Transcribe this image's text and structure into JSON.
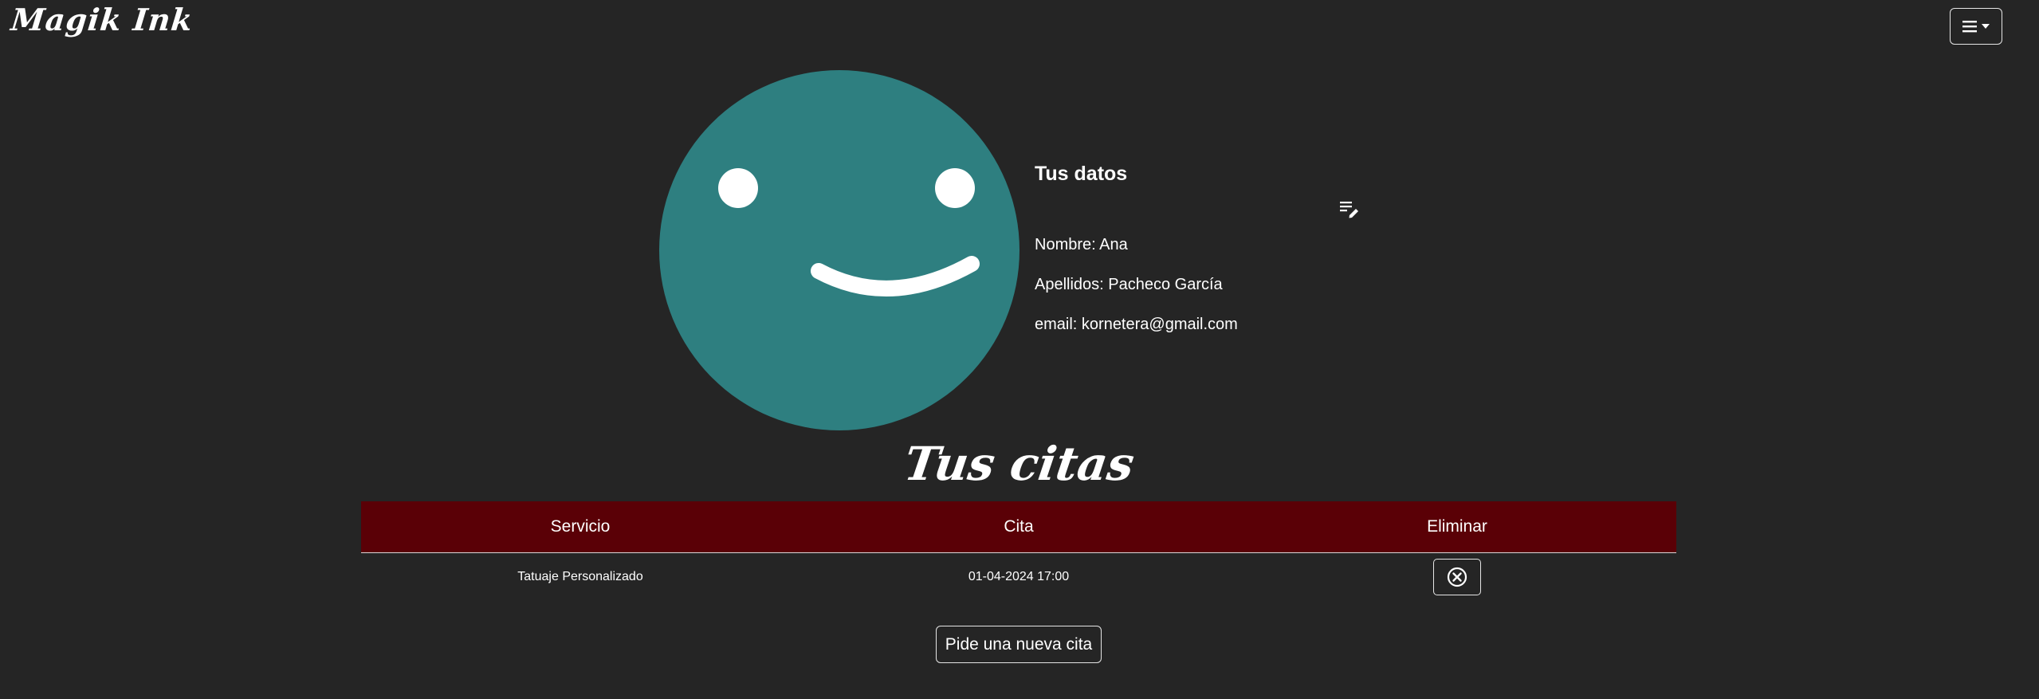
{
  "navbar": {
    "brand": "Magik Ink",
    "menu_icon": "hamburger-dropdown-icon"
  },
  "profile": {
    "avatar_icon": "smiley-face-icon",
    "avatar_color": "#2e7f80",
    "title": "Tus datos",
    "edit_icon": "edit-list-icon",
    "nombre": "Nombre: Ana",
    "apellidos": "Apellidos: Pacheco García",
    "email": "email: kornetera@gmail.com"
  },
  "appointments": {
    "title": "Tus citas",
    "header_color": "#5a0006",
    "columns": [
      "Servicio",
      "Cita",
      "Eliminar"
    ],
    "rows": [
      {
        "servicio": "Tatuaje Personalizado",
        "cita": "01-04-2024 17:00",
        "delete_icon": "circle-x-icon"
      }
    ],
    "new_button": "Pide una nueva cita"
  }
}
